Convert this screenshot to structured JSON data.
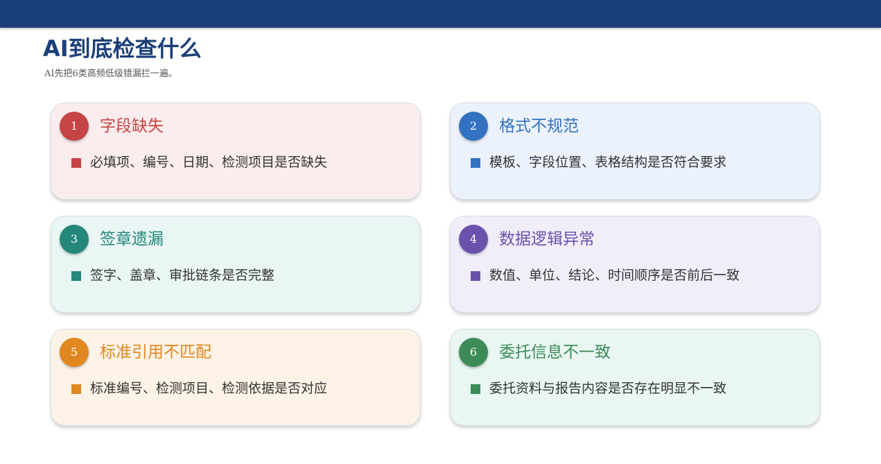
{
  "header": {
    "title": "AI到底检查什么",
    "subtitle": "AI先把6类高频低级错漏拦一遍。"
  },
  "cards": [
    {
      "number": "1",
      "title": "字段缺失",
      "text": "必填项、编号、日期、检测项目是否缺失",
      "accent": "#c64444",
      "bg": "#fbeded"
    },
    {
      "number": "2",
      "title": "格式不规范",
      "text": "模板、字段位置、表格结构是否符合要求",
      "accent": "#3272c0",
      "bg": "#ebf2fc"
    },
    {
      "number": "3",
      "title": "签章遗漏",
      "text": "签字、盖章、审批链条是否完整",
      "accent": "#23877a",
      "bg": "#e9f6f4"
    },
    {
      "number": "4",
      "title": "数据逻辑异常",
      "text": "数值、单位、结论、时间顺序是否前后一致",
      "accent": "#6a52ac",
      "bg": "#f1eefa"
    },
    {
      "number": "5",
      "title": "标准引用不匹配",
      "text": "标准编号、检测项目、检测依据是否对应",
      "accent": "#e0871f",
      "bg": "#fcf2e6"
    },
    {
      "number": "6",
      "title": "委托信息不一致",
      "text": "委托资料与报告内容是否存在明显不一致",
      "accent": "#3d8c58",
      "bg": "#e9f6f2"
    }
  ]
}
